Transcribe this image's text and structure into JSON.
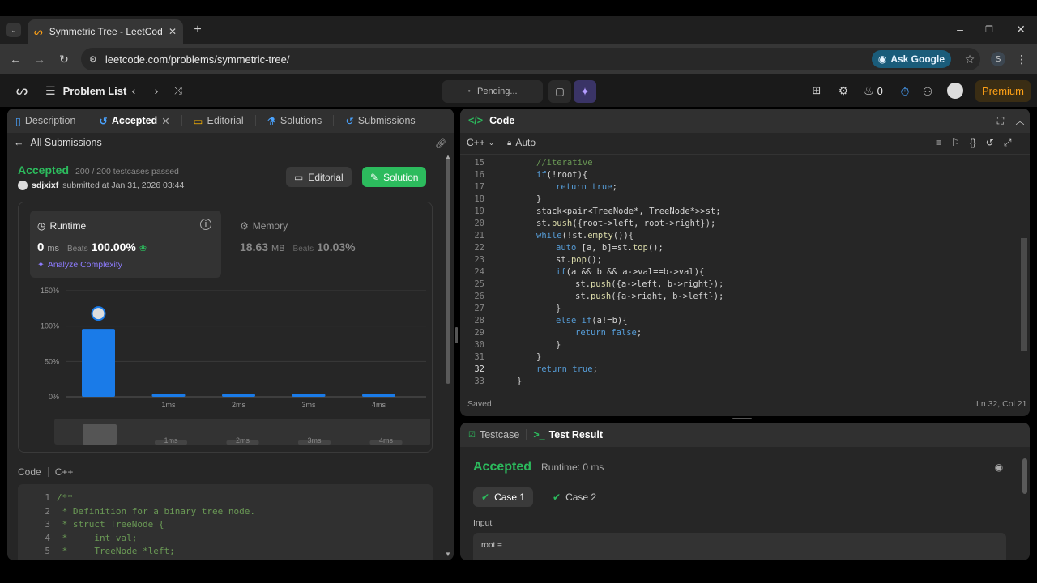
{
  "browser": {
    "tab_title": "Symmetric Tree - LeetCode",
    "url": "leetcode.com/problems/symmetric-tree/",
    "ask_google": "Ask Google",
    "profile_initial": "S"
  },
  "header": {
    "problem_list": "Problem List",
    "pending": "Pending...",
    "streak": "0",
    "premium": "Premium"
  },
  "left": {
    "tabs": [
      {
        "label": "Description"
      },
      {
        "label": "Accepted"
      },
      {
        "label": "Editorial"
      },
      {
        "label": "Solutions"
      },
      {
        "label": "Submissions"
      }
    ],
    "all_submissions": "All Submissions",
    "status": "Accepted",
    "testcases": "200 / 200 testcases passed",
    "user": "sdjxixf",
    "submitted": "submitted at Jan 31, 2026 03:44",
    "editorial_btn": "Editorial",
    "solution_btn": "Solution",
    "runtime_label": "Runtime",
    "runtime_value": "0",
    "runtime_unit": "ms",
    "beats_label": "Beats",
    "runtime_beats": "100.00%",
    "analyze": "Analyze Complexity",
    "memory_label": "Memory",
    "memory_value": "18.63",
    "memory_unit": "MB",
    "memory_beats": "10.03%",
    "code_label": "Code",
    "code_lang": "C++",
    "snippet": [
      {
        "n": "1",
        "t": "/**"
      },
      {
        "n": "2",
        "t": " * Definition for a binary tree node."
      },
      {
        "n": "3",
        "t": " * struct TreeNode {"
      },
      {
        "n": "4",
        "t": " *     int val;"
      },
      {
        "n": "5",
        "t": " *     TreeNode *left;"
      }
    ]
  },
  "chart_data": {
    "type": "bar",
    "categories": [
      "",
      "1ms",
      "2ms",
      "3ms",
      "4ms"
    ],
    "values": [
      96,
      4,
      4,
      4,
      4
    ],
    "yticks": [
      "150%",
      "100%",
      "50%",
      "0%"
    ],
    "ylim": [
      0,
      150
    ],
    "grid": true,
    "overview_labels": [
      "1ms",
      "2ms",
      "3ms",
      "4ms"
    ]
  },
  "editor": {
    "title": "Code",
    "lang": "C++",
    "mode": "Auto",
    "saved": "Saved",
    "cursor": "Ln 32, Col 21",
    "lines": [
      {
        "n": "15",
        "i": 1,
        "html": "<span class='cm'>//iterative</span>"
      },
      {
        "n": "16",
        "i": 1,
        "html": "<span class='kw'>if</span>(!root){"
      },
      {
        "n": "17",
        "i": 2,
        "html": "<span class='kw'>return</span> <span class='kw'>true</span>;"
      },
      {
        "n": "18",
        "i": 1,
        "html": "}"
      },
      {
        "n": "19",
        "i": 1,
        "html": "stack&lt;pair&lt;TreeNode*, TreeNode*&gt;&gt;st;"
      },
      {
        "n": "20",
        "i": 1,
        "html": "st.<span class='fn'>push</span>({root-&gt;left, root-&gt;right});"
      },
      {
        "n": "21",
        "i": 1,
        "html": "<span class='kw'>while</span>(!st.<span class='fn'>empty</span>()){"
      },
      {
        "n": "22",
        "i": 2,
        "html": "<span class='kw'>auto</span> [a, b]=st.<span class='fn'>top</span>();"
      },
      {
        "n": "23",
        "i": 2,
        "html": "st.<span class='fn'>pop</span>();"
      },
      {
        "n": "24",
        "i": 2,
        "html": "<span class='kw'>if</span>(a &amp;&amp; b &amp;&amp; a-&gt;val==b-&gt;val){"
      },
      {
        "n": "25",
        "i": 3,
        "html": "st.<span class='fn'>push</span>({a-&gt;left, b-&gt;right});"
      },
      {
        "n": "26",
        "i": 3,
        "html": "st.<span class='fn'>push</span>({a-&gt;right, b-&gt;left});"
      },
      {
        "n": "27",
        "i": 2,
        "html": "}"
      },
      {
        "n": "28",
        "i": 2,
        "html": "<span class='kw'>else</span> <span class='kw'>if</span>(a!=b){"
      },
      {
        "n": "29",
        "i": 3,
        "html": "<span class='kw'>return</span> <span class='kw'>false</span>;"
      },
      {
        "n": "30",
        "i": 2,
        "html": "}"
      },
      {
        "n": "31",
        "i": 1,
        "html": "}"
      },
      {
        "n": "32",
        "i": 1,
        "html": "<span class='kw'>return</span> <span class='kw'>true</span>;"
      },
      {
        "n": "33",
        "i": 0,
        "html": "}"
      }
    ]
  },
  "result": {
    "testcase_tab": "Testcase",
    "result_tab": "Test Result",
    "status": "Accepted",
    "runtime": "Runtime: 0 ms",
    "case1": "Case 1",
    "case2": "Case 2",
    "input_label": "Input",
    "input_value": "root ="
  },
  "colors": {
    "accent_green": "#2cbb5d",
    "bar_blue": "#1a7be8",
    "premium": "#ffa116"
  }
}
